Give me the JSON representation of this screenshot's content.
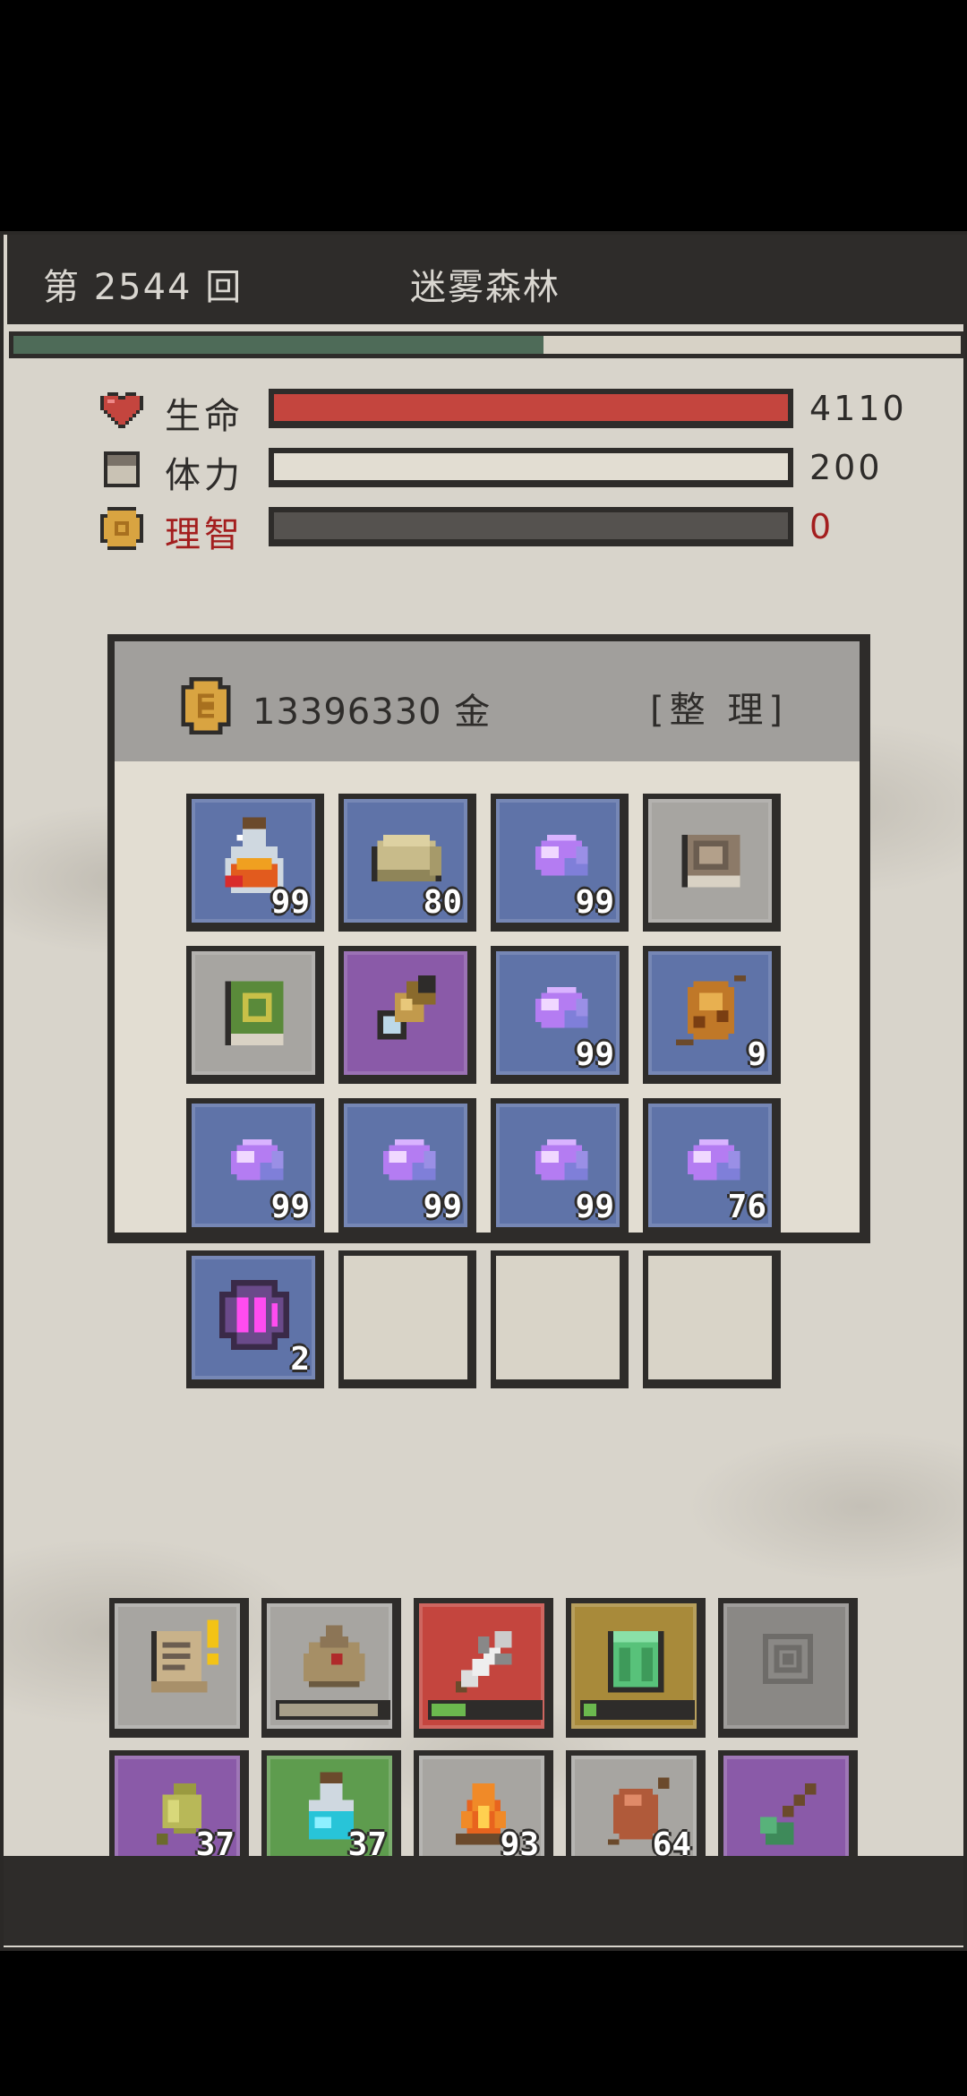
{
  "header": {
    "round": "第 2544 回",
    "area": "迷雾森林",
    "progress": 0.56
  },
  "stats": [
    {
      "label": "生命",
      "value": "4110",
      "fill": 1.0,
      "color": "#c4453e",
      "label_color": "#2e2c2a",
      "icon": "heart-icon"
    },
    {
      "label": "体力",
      "value": "200",
      "fill": 1.0,
      "color": "#e2ddd2",
      "label_color": "#2e2c2a",
      "icon": "stamina-icon"
    },
    {
      "label": "理智",
      "value": "0",
      "fill": 0.0,
      "color": "#55524f",
      "label_color": "#a31e1e",
      "icon": "sanity-coin-icon"
    }
  ],
  "inventory": {
    "gold": "13396330 金",
    "sort_label": "[整 理]",
    "slots": [
      {
        "item": "potion-icon",
        "bg": "blue",
        "count": "99"
      },
      {
        "item": "ore-icon",
        "bg": "blue",
        "count": "80"
      },
      {
        "item": "crystal-icon",
        "bg": "blue",
        "count": "99"
      },
      {
        "item": "journal-icon",
        "bg": "gray",
        "count": ""
      },
      {
        "item": "green-book-icon",
        "bg": "gray",
        "count": ""
      },
      {
        "item": "spyglass-icon",
        "bg": "purple",
        "count": ""
      },
      {
        "item": "crystal-icon",
        "bg": "blue",
        "count": "99"
      },
      {
        "item": "skewer-icon",
        "bg": "blue",
        "count": "9"
      },
      {
        "item": "crystal-icon",
        "bg": "blue",
        "count": "99"
      },
      {
        "item": "crystal-icon",
        "bg": "blue",
        "count": "99"
      },
      {
        "item": "crystal-icon",
        "bg": "blue",
        "count": "99"
      },
      {
        "item": "crystal-icon",
        "bg": "blue",
        "count": "76"
      },
      {
        "item": "rune-orb-icon",
        "bg": "blue",
        "count": "2"
      },
      {
        "item": "",
        "bg": "empty",
        "count": ""
      },
      {
        "item": "",
        "bg": "empty",
        "count": ""
      },
      {
        "item": "",
        "bg": "empty",
        "count": ""
      }
    ]
  },
  "actions_row1": [
    {
      "item": "scroll-quest-icon",
      "bg": "lgray",
      "meter": null,
      "alert": true
    },
    {
      "item": "sack-icon",
      "bg": "lgray",
      "meter": {
        "fill": 0.92,
        "color": "#a89f89"
      }
    },
    {
      "item": "sword-icon",
      "bg": "red",
      "meter": {
        "fill": 0.32,
        "color": "#6bb84e"
      }
    },
    {
      "item": "armor-icon",
      "bg": "khaki",
      "meter": {
        "fill": 0.12,
        "color": "#6bb84e"
      }
    },
    {
      "item": "spiral-icon",
      "bg": "slate",
      "meter": null
    }
  ],
  "actions_row2": [
    {
      "item": "herb-icon",
      "bg": "purple",
      "count": "37"
    },
    {
      "item": "cyan-potion-icon",
      "bg": "green",
      "count": "37"
    },
    {
      "item": "campfire-icon",
      "bg": "lgray",
      "count": "93"
    },
    {
      "item": "meat-icon",
      "bg": "lgray",
      "count": "64"
    },
    {
      "item": "axe-icon",
      "bg": "purple",
      "count": ""
    }
  ]
}
